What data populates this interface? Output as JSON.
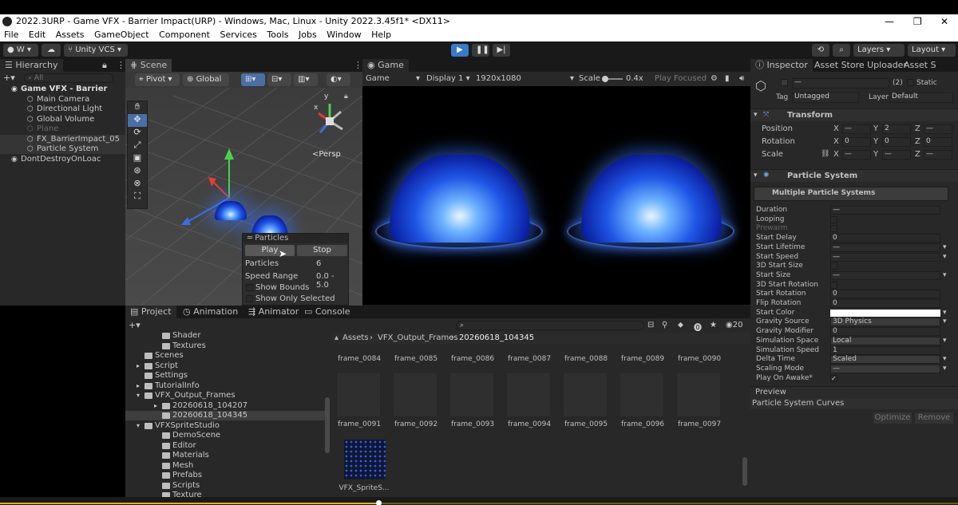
{
  "window": {
    "title": "2022.3URP - Game VFX - Barrier Impact(URP) - Windows, Mac, Linux - Unity 2022.3.45f1* <DX11>",
    "minimize": "—",
    "maximize": "❐",
    "close": "✕"
  },
  "menu": [
    "File",
    "Edit",
    "Assets",
    "GameObject",
    "Component",
    "Services",
    "Tools",
    "Jobs",
    "Window",
    "Help"
  ],
  "toolbar": {
    "account": "W",
    "vcs": "Unity VCS",
    "layers": "Layers",
    "layout": "Layout"
  },
  "hierarchy": {
    "tab": "Hierarchy",
    "search_placeholder": "All",
    "items": [
      {
        "label": "Game VFX - Barrier",
        "level": 0,
        "bold": true
      },
      {
        "label": "Main Camera",
        "level": 1
      },
      {
        "label": "Directional Light",
        "level": 1
      },
      {
        "label": "Global Volume",
        "level": 1
      },
      {
        "label": "Plane",
        "level": 1,
        "dim": true
      },
      {
        "label": "FX_BarrierImpact_05",
        "level": 1
      },
      {
        "label": "Particle System",
        "level": 1
      },
      {
        "label": "DontDestroyOnLoac",
        "level": 0
      }
    ]
  },
  "scene": {
    "tab": "Scene",
    "pivot": "Pivot",
    "global": "Global",
    "persp": "<Persp",
    "gizmo_y": "y",
    "gizmo_x": "x",
    "particles": {
      "title": "Particles",
      "play": "Play",
      "stop": "Stop",
      "particles_label": "Particles",
      "particles_value": "6",
      "speed_label": "Speed Range",
      "speed_value": "0.0 - 5.0",
      "show_bounds": "Show Bounds",
      "show_selected": "Show Only Selected"
    }
  },
  "game": {
    "tab": "Game",
    "mode": "Game",
    "display": "Display 1",
    "resolution": "1920x1080",
    "scale_label": "Scale",
    "scale_value": "0.4x",
    "play_focused": "Play Focused"
  },
  "inspector": {
    "tabs": [
      "Inspector",
      "Asset Store Uploader",
      "Asset S"
    ],
    "count": "(2)",
    "static": "Static",
    "tag_label": "Tag",
    "tag": "Untagged",
    "layer_label": "Layer",
    "layer": "Default",
    "name_value": "—",
    "transform": {
      "title": "Transform",
      "rows": [
        {
          "label": "Position",
          "x": "—",
          "y": "2",
          "z": "—"
        },
        {
          "label": "Rotation",
          "x": "0",
          "y": "0",
          "z": "0"
        },
        {
          "label": "Scale",
          "x": "—",
          "y": "—",
          "z": "—"
        }
      ]
    },
    "particle_system": {
      "title": "Particle System",
      "subtitle": "Multiple Particle Systems",
      "rows": [
        {
          "label": "Duration",
          "value": "—"
        },
        {
          "label": "Looping",
          "value": ""
        },
        {
          "label": "Prewarm",
          "value": ""
        },
        {
          "label": "Start Delay",
          "value": "0"
        },
        {
          "label": "Start Lifetime",
          "value": "—"
        },
        {
          "label": "Start Speed",
          "value": "—"
        },
        {
          "label": "3D Start Size",
          "value": ""
        },
        {
          "label": "Start Size",
          "value": "—"
        },
        {
          "label": "3D Start Rotation",
          "value": ""
        },
        {
          "label": "Start Rotation",
          "value": "0"
        },
        {
          "label": "Flip Rotation",
          "value": "0"
        },
        {
          "label": "Start Color",
          "value": ""
        },
        {
          "label": "Gravity Source",
          "value": "3D Physics"
        },
        {
          "label": "Gravity Modifier",
          "value": "0"
        },
        {
          "label": "Simulation Space",
          "value": "Local"
        },
        {
          "label": "Simulation Speed",
          "value": "1"
        },
        {
          "label": "Delta Time",
          "value": "Scaled"
        },
        {
          "label": "Scaling Mode",
          "value": "—"
        },
        {
          "label": "Play On Awake*",
          "value": "✓"
        }
      ]
    },
    "preview": "Preview",
    "curves": "Particle System Curves",
    "optimize": "Optimize",
    "remove": "Remove"
  },
  "project": {
    "tabs": [
      "Project",
      "Animation",
      "Animator",
      "Console"
    ],
    "hidden_count": "20",
    "breadcrumb": [
      "Assets",
      "VFX_Output_Frames",
      "20260618_104345"
    ],
    "tree": [
      {
        "label": "Shader",
        "level": 2
      },
      {
        "label": "Textures",
        "level": 2
      },
      {
        "label": "Scenes",
        "level": 1
      },
      {
        "label": "Script",
        "level": 1
      },
      {
        "label": "Settings",
        "level": 1
      },
      {
        "label": "TutorialInfo",
        "level": 1
      },
      {
        "label": "VFX_Output_Frames",
        "level": 1
      },
      {
        "label": "20260618_104207",
        "level": 2
      },
      {
        "label": "20260618_104345",
        "level": 2,
        "selected": true
      },
      {
        "label": "VFXSpriteStudio",
        "level": 1
      },
      {
        "label": "DemoScene",
        "level": 2
      },
      {
        "label": "Editor",
        "level": 2
      },
      {
        "label": "Materials",
        "level": 2
      },
      {
        "label": "Mesh",
        "level": 2
      },
      {
        "label": "Prefabs",
        "level": 2
      },
      {
        "label": "Scripts",
        "level": 2
      },
      {
        "label": "Texture",
        "level": 2
      }
    ],
    "row1": [
      "frame_0084",
      "frame_0085",
      "frame_0086",
      "frame_0087",
      "frame_0088",
      "frame_0089",
      "frame_0090"
    ],
    "row2": [
      "frame_0091",
      "frame_0092",
      "frame_0093",
      "frame_0094",
      "frame_0095",
      "frame_0096",
      "frame_0097"
    ],
    "sprite": "VFX_SpriteS..."
  }
}
